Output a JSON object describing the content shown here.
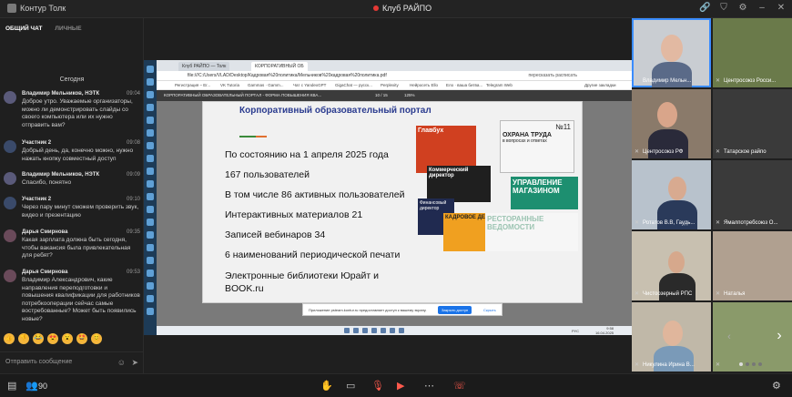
{
  "app": {
    "title": "Контур Толк",
    "room": "Клуб РАЙПО"
  },
  "top_icons": [
    "link-icon",
    "shield-icon",
    "gear-icon",
    "minimize-icon",
    "close-icon"
  ],
  "chat": {
    "tabs": [
      {
        "label": "ОБЩИЙ ЧАТ",
        "active": true
      },
      {
        "label": "ЛИЧНЫЕ",
        "active": false
      }
    ],
    "date_separator": "Сегодня",
    "messages": [
      {
        "author": "Владимир Мельников, НЭТК",
        "time": "09:04",
        "text": "Доброе утро. Уважаемые организаторы, можно ли демонстрировать слайды со своего компьютера или их нужно отправить вам?"
      },
      {
        "author": "Участник 2",
        "time": "09:08",
        "text": "Добрый день, да, конечно можно, нужно нажать кнопку совместный доступ"
      },
      {
        "author": "Владимир Мельников, НЭТК",
        "time": "09:09",
        "text": "Спасибо, понятно"
      },
      {
        "author": "Участник 2",
        "time": "09:10",
        "text": "Через пару минут сможем проверить звук, видео и презентацию"
      },
      {
        "author": "Дарья Смирнова",
        "time": "09:35",
        "text": "Какая зарплата должна быть сегодня, чтобы вакансия была привлекательная для ребят?"
      },
      {
        "author": "Дарья Смирнова",
        "time": "09:53",
        "text": "Владимир Александрович, какие направления переподготовки и повышения квалификации для работников потребкооперации сейчас самые востребованные? Может быть появились новые?"
      }
    ],
    "reactions": [
      "👍",
      "👎",
      "😂",
      "😍",
      "😮",
      "🤩",
      "😊"
    ],
    "send_placeholder": "Отправить сообщение"
  },
  "share": {
    "tabs": [
      {
        "label": "Клуб РАЙПО — Толк",
        "active": false
      },
      {
        "label": "КОРПОРАТИВНЫЙ ОБ",
        "active": true
      }
    ],
    "url": "file:///C:/Users/VLAD/Desktop/Кадровая%20политика/Мельников%20кадровая%20политика.pdf",
    "addr_right": "пересказать   расписать",
    "bookmarks": [
      "Регистрация – Ег...",
      "VK Tutoria",
      "Gammas · Gamm...",
      "Чат с YandexGPT",
      "GigaChat — русск...",
      "Perplexity",
      "Нейросеть Ello",
      "Ело · ваша битва...",
      "Telegram Web"
    ],
    "bookmarks_other": "Другие закладки",
    "pdf_title": "КОРПОРАТИВНЫЙ ОБРАЗОВАТЕЛЬНЫЙ ПОРТАЛ - ФОРМА ПОВЫШЕНИЯ КВА...",
    "pdf_page": "10 / 15",
    "pdf_zoom": "125%",
    "slide": {
      "heading": "Корпоративный образовательный портал",
      "stats": [
        "По состоянию на 1 апреля 2025 года",
        "167 пользователей",
        "В том числе 86 активных пользователей",
        "Интерактивных материалов 21",
        "Записей вебинаров 34",
        "6 наименований периодической печати",
        "Электронные библиотеки Юрайт и BOOK.ru"
      ],
      "covers": {
        "glavbukh": "Главбух",
        "kommersant": "Коммерческий директор",
        "fin_dir": "Финансовый директор",
        "kadrovoe": "КАДРОВОЕ ДЕЛО",
        "okhrana": "ОХРАНА ТРУДА",
        "okhrana_sub": "в вопросах и ответах",
        "okhrana_num": "№11",
        "upravlenie": "УПРАВЛЕНИЕ МАГАЗИНОМ",
        "restoran": "РЕСТОРАННЫЕ ВЕДОМОСТИ"
      }
    },
    "notify": {
      "text": "Приложение psteam.kontur.ru предоставляет доступ к вашему экрану.",
      "button": "Закрыть доступ",
      "close": "Скрыть"
    },
    "taskbar": {
      "lang": "РУС",
      "time": "9:58",
      "date": "16.04.2025"
    }
  },
  "participants": [
    {
      "name": "Владимир Мельн...",
      "speaking": true,
      "muted": false
    },
    {
      "name": "Центросоюз Росси...",
      "speaking": false,
      "muted": true
    },
    {
      "name": "Центросоюз РФ",
      "speaking": false,
      "muted": true
    },
    {
      "name": "Татарское райпо",
      "speaking": false,
      "muted": true
    },
    {
      "name": "Ротатов В.В, Гаудь...",
      "speaking": false,
      "muted": true
    },
    {
      "name": "Ямалпотребсоюз О...",
      "speaking": false,
      "muted": true
    },
    {
      "name": "Чистоозерный РПС",
      "speaking": false,
      "muted": true
    },
    {
      "name": "Наталья",
      "speaking": false,
      "muted": true
    },
    {
      "name": "Никулина Ирина В...",
      "speaking": false,
      "muted": true
    },
    {
      "name": "",
      "speaking": false,
      "muted": true
    }
  ],
  "bottom": {
    "participants_count": "90",
    "icons": [
      "people-icon",
      "hand-icon",
      "share-screen-icon",
      "mic-off-icon",
      "camera-off-icon",
      "more-icon",
      "leave-call-icon",
      "settings-icon"
    ]
  }
}
